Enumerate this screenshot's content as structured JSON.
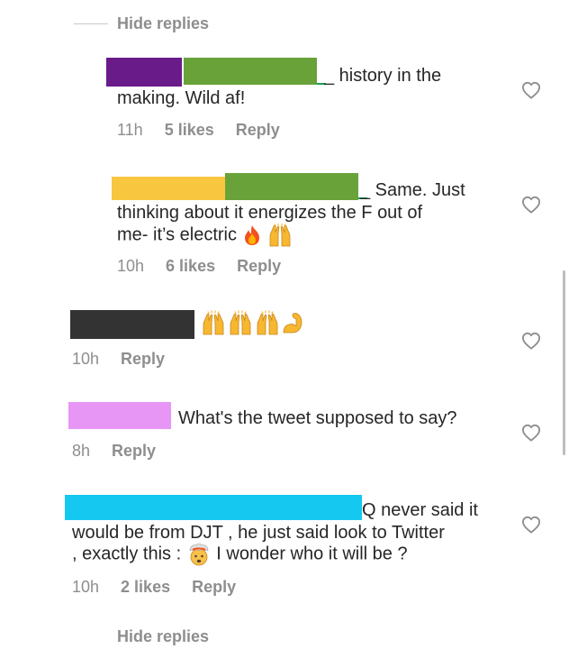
{
  "thread": {
    "hide_replies_top": "Hide replies",
    "hide_replies_bottom": "Hide replies"
  },
  "colors": {
    "redact_purple": "#6a1b8a",
    "redact_green": "#6aa23a",
    "redact_yellow": "#f8c63f",
    "redact_dark": "#333333",
    "redact_pink": "#e796f6",
    "redact_cyan": "#14c8f0",
    "meta_gray": "#8e8e8e"
  },
  "comments": [
    {
      "text_line1": "_ history in the",
      "text_line2": "making. Wild af!",
      "time": "11h",
      "likes": "5 likes",
      "reply": "Reply",
      "heart_icon": "heart-outline-icon"
    },
    {
      "text_line1": "_ Same. Just",
      "text_line2": "thinking about it energizes the F out of",
      "text_line3": "me- it’s electric",
      "emojis": [
        "fire-icon",
        "raised-hands-icon"
      ],
      "time": "10h",
      "likes": "6 likes",
      "reply": "Reply",
      "heart_icon": "heart-outline-icon"
    },
    {
      "emojis": [
        "raised-hands-icon",
        "raised-hands-icon",
        "raised-hands-icon",
        "flexed-biceps-icon"
      ],
      "time": "10h",
      "reply": "Reply",
      "heart_icon": "heart-outline-icon"
    },
    {
      "text_line1": "What's the tweet supposed to say?",
      "time": "8h",
      "reply": "Reply",
      "heart_icon": "heart-outline-icon"
    },
    {
      "text_line1": "Q never said it",
      "text_line2": "would be from DJT , he just said look to Twitter",
      "text_line3a": ", exactly this :",
      "text_line3b": "I wonder who it will be ?",
      "emojis": [
        "exploding-head-icon"
      ],
      "time": "10h",
      "likes": "2 likes",
      "reply": "Reply",
      "heart_icon": "heart-outline-icon"
    }
  ]
}
